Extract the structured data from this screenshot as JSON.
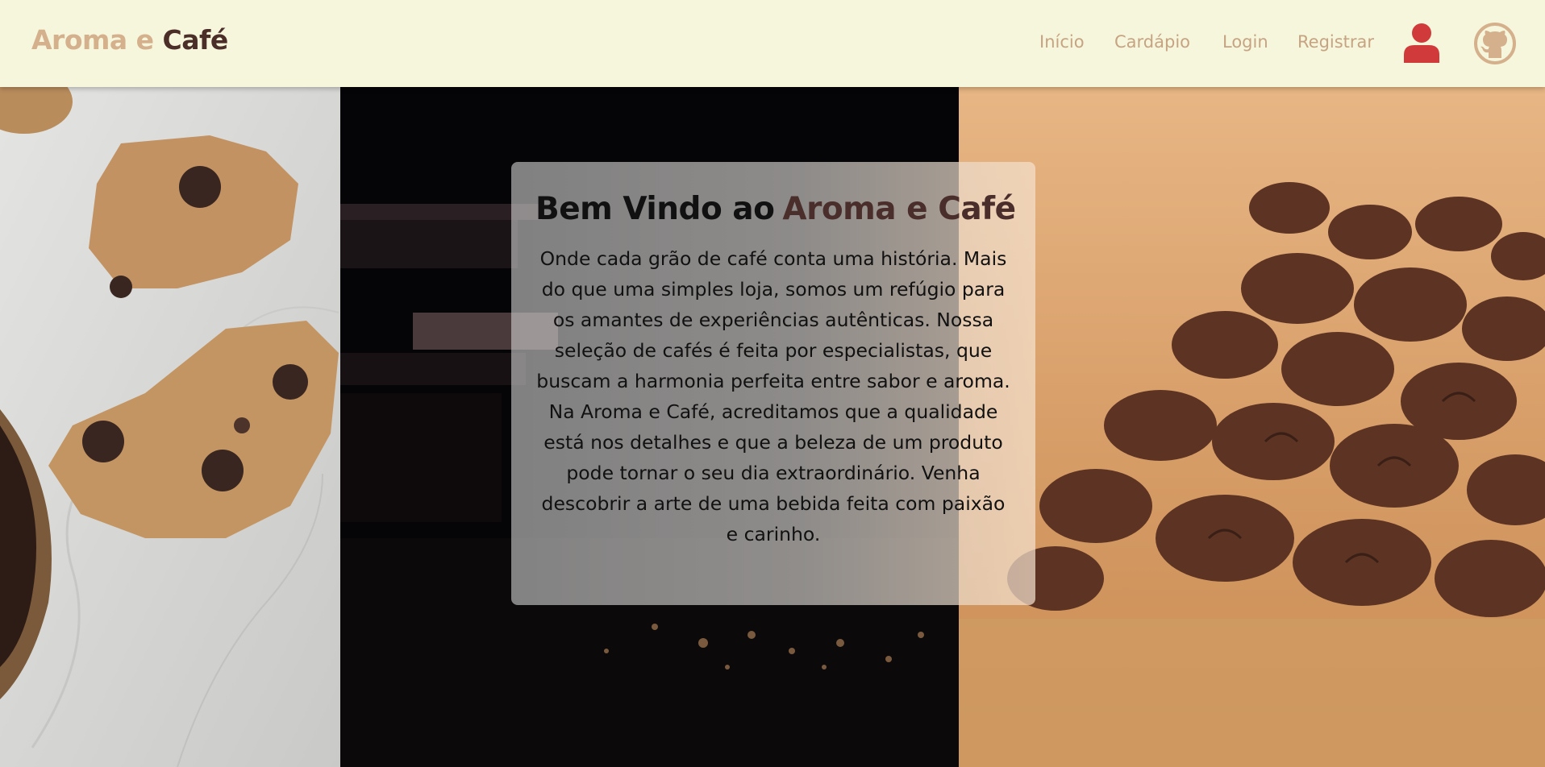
{
  "header": {
    "brand_part1": "Aroma e",
    "brand_part2": "Café",
    "nav": {
      "inicio": "Início",
      "cardapio": "Cardápio",
      "login": "Login",
      "registrar": "Registrar"
    },
    "icons": {
      "user": "user-icon",
      "github": "github-icon"
    },
    "colors": {
      "background": "#f6f6dc",
      "nav_text": "#c6a382",
      "user_icon": "#d13a3a",
      "github_icon": "#d4b08c"
    }
  },
  "hero": {
    "panels": [
      "cookies-image",
      "chocolate-image",
      "coffee-beans-image"
    ],
    "card": {
      "title": "Bem Vindo ao",
      "title_brand": "Aroma e Café",
      "text": "Onde cada grão de café conta uma história. Mais do que uma simples loja, somos um refúgio para os amantes de experiências autênticas. Nossa seleção de cafés é feita por especialistas, que buscam a harmonia perfeita entre sabor e aroma. Na Aroma e Café, acreditamos que a qualidade está nos detalhes e que a beleza de um produto pode tornar o seu dia extraordinário. Venha descobrir a arte de uma bebida feita com paixão e carinho."
    }
  }
}
